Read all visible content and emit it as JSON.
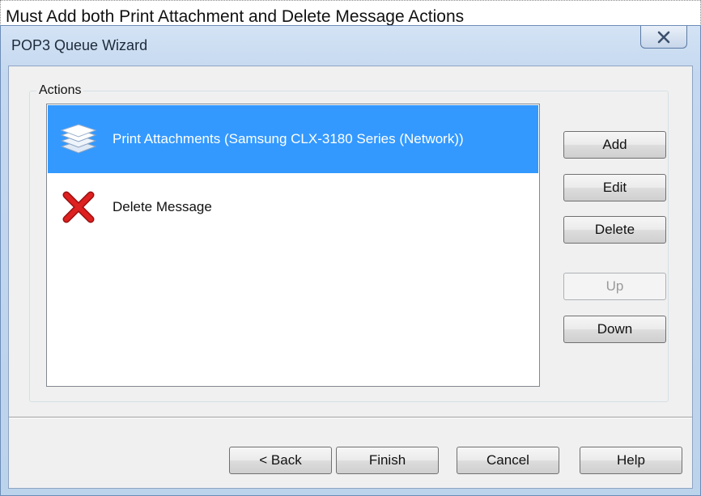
{
  "caption": "Must Add both Print Attachment and Delete Message Actions",
  "window": {
    "title": "POP3 Queue Wizard",
    "close_icon": "close-icon"
  },
  "actions": {
    "group_label": "Actions",
    "items": [
      {
        "label": "Print Attachments (Samsung CLX-3180 Series (Network))",
        "icon": "layers-icon",
        "selected": true
      },
      {
        "label": "Delete Message",
        "icon": "red-x-icon",
        "selected": false
      }
    ]
  },
  "side_buttons": {
    "add": "Add",
    "edit": "Edit",
    "delete": "Delete",
    "up": "Up",
    "down": "Down"
  },
  "footer_buttons": {
    "back": "< Back",
    "finish": "Finish",
    "cancel": "Cancel",
    "help": "Help"
  },
  "colors": {
    "selection": "#3399ff",
    "delete_icon": "#cc1111"
  }
}
